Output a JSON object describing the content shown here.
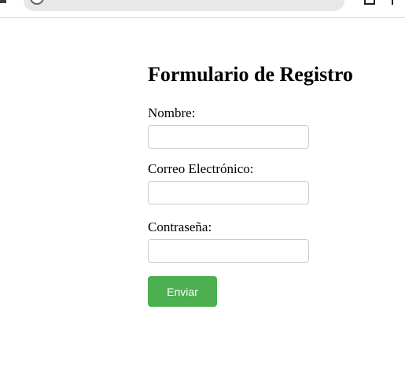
{
  "form": {
    "title": "Formulario de Registro",
    "fields": [
      {
        "label": "Nombre:",
        "value": "",
        "type": "text"
      },
      {
        "label": "Correo Electrónico:",
        "value": "",
        "type": "email"
      },
      {
        "label": "Contraseña:",
        "value": "",
        "type": "password"
      }
    ],
    "submit_label": "Enviar"
  },
  "colors": {
    "submit_button": "#4caf50",
    "input_border": "#cccccc"
  },
  "icons": {
    "browser_bar": [
      "site-info-icon",
      "key-icon",
      "bookmark-star-icon",
      "tab-icon",
      "menu-icon"
    ]
  }
}
